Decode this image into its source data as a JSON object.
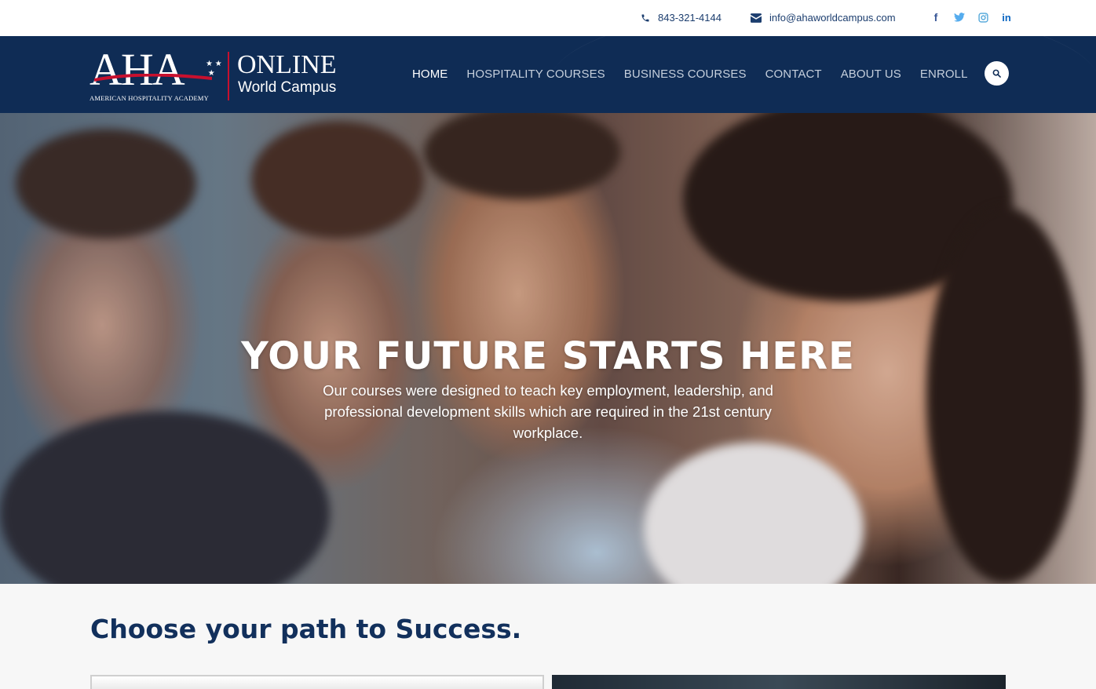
{
  "topbar": {
    "phone": "843-321-4144",
    "email": "info@ahaworldcampus.com",
    "icons": [
      "phone-icon",
      "envelope-icon"
    ],
    "social": [
      "facebook-icon",
      "twitter-icon",
      "instagram-icon",
      "linkedin-icon"
    ],
    "social_glyphs": {
      "facebook": "f",
      "twitter": "🐦",
      "instagram": "◎",
      "linkedin": "in"
    }
  },
  "logo": {
    "mark": "AHA",
    "academy": "AMERICAN HOSPITALITY ACADEMY",
    "online": "ONLINE",
    "campus": "World Campus"
  },
  "nav": {
    "items": [
      {
        "label": "HOME",
        "active": true
      },
      {
        "label": "HOSPITALITY COURSES",
        "active": false
      },
      {
        "label": "BUSINESS COURSES",
        "active": false
      },
      {
        "label": "CONTACT",
        "active": false
      },
      {
        "label": "ABOUT US",
        "active": false
      },
      {
        "label": "ENROLL",
        "active": false
      }
    ],
    "search_icon": "search-icon"
  },
  "hero": {
    "title": "YOUR FUTURE STARTS HERE",
    "subtitle": "Our courses were designed to teach key employment, leadership, and professional development skills which are required in the 21st century workplace."
  },
  "section": {
    "heading": "Choose your path to Success."
  },
  "colors": {
    "navy": "#0f2c55",
    "heading": "#12305c",
    "accent_red": "#c8102e"
  }
}
